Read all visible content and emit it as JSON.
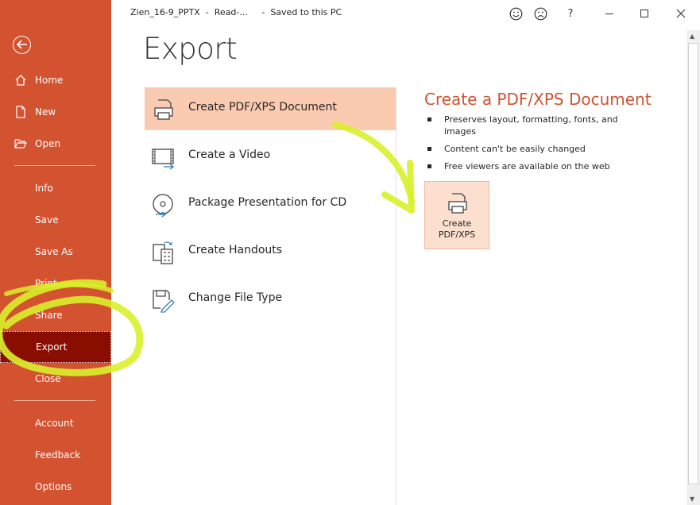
{
  "window": {
    "title": "Zien_16-9_PPTX  -  Read-...     -  Saved to this PC"
  },
  "sidebar": {
    "items": [
      {
        "label": "Home",
        "icon": "home-icon"
      },
      {
        "label": "New",
        "icon": "new-file-icon"
      },
      {
        "label": "Open",
        "icon": "folder-open-icon"
      },
      {
        "label": "Info"
      },
      {
        "label": "Save"
      },
      {
        "label": "Save As"
      },
      {
        "label": "Print"
      },
      {
        "label": "Share"
      },
      {
        "label": "Export",
        "active": true
      },
      {
        "label": "Close"
      },
      {
        "label": "Account"
      },
      {
        "label": "Feedback"
      },
      {
        "label": "Options"
      }
    ]
  },
  "titlebar": {
    "smile_icon": "smiley-icon",
    "frown_icon": "frown-icon",
    "help": "?"
  },
  "main": {
    "title": "Export",
    "options": [
      {
        "label": "Create PDF/XPS Document",
        "icon": "pdf-document-icon",
        "selected": true
      },
      {
        "label": "Create a Video",
        "icon": "video-icon"
      },
      {
        "label": "Package Presentation for CD",
        "icon": "cd-icon"
      },
      {
        "label": "Create Handouts",
        "icon": "handouts-icon"
      },
      {
        "label": "Change File Type",
        "icon": "file-type-icon"
      }
    ]
  },
  "detail": {
    "title": "Create a PDF/XPS Document",
    "bullets": [
      "Preserves layout, formatting, fonts, and images",
      "Content can't be easily changed",
      "Free viewers are available on the web"
    ],
    "button_line1": "Create",
    "button_line2": "PDF/XPS"
  },
  "colors": {
    "accent": "#d35230",
    "active_nav": "#8a0e00",
    "selected_option": "#fbcbb1",
    "annotation_highlight": "#d9ef2b"
  }
}
